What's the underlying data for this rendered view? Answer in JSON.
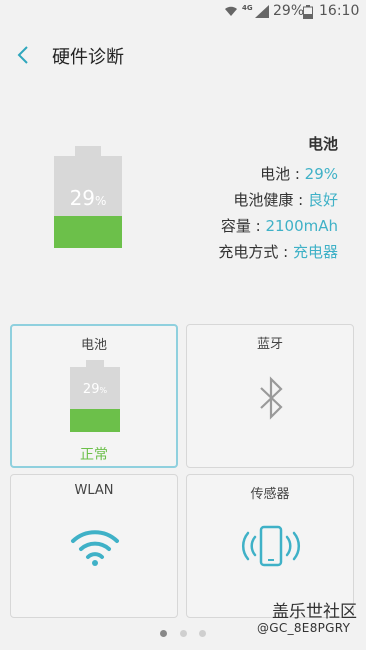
{
  "status_bar": {
    "network": "4G",
    "battery_text": "29%",
    "time": "16:10"
  },
  "header": {
    "title": "硬件诊断"
  },
  "battery_summary": {
    "section_title": "电池",
    "level_percent": 29,
    "big_label_num": "29",
    "big_label_unit": "%",
    "rows": [
      {
        "label": "电池 : ",
        "value": "29%"
      },
      {
        "label": "电池健康 : ",
        "value": "良好"
      },
      {
        "label": "容量 : ",
        "value": "2100mAh"
      },
      {
        "label": "充电方式 : ",
        "value": "充电器"
      }
    ]
  },
  "tiles": [
    {
      "label": "电池",
      "battery_num": "29",
      "battery_unit": "%",
      "status": "正常"
    },
    {
      "label": "蓝牙"
    },
    {
      "label": "WLAN"
    },
    {
      "label": "传感器"
    }
  ],
  "pager": {
    "count": 3,
    "active": 0
  },
  "watermark": {
    "line1": "盖乐世社区",
    "line2": "@GC_8E8PGRY"
  },
  "colors": {
    "accent": "#3fb1c7",
    "battery_fill": "#6cc04a",
    "battery_empty": "#d8d8d8",
    "ok": "#6cc04a"
  },
  "icons": [
    "wifi-status-icon",
    "signal-icon",
    "battery-status-icon",
    "back-arrow-icon",
    "bluetooth-icon",
    "wifi-icon",
    "phone-vibrate-icon"
  ]
}
